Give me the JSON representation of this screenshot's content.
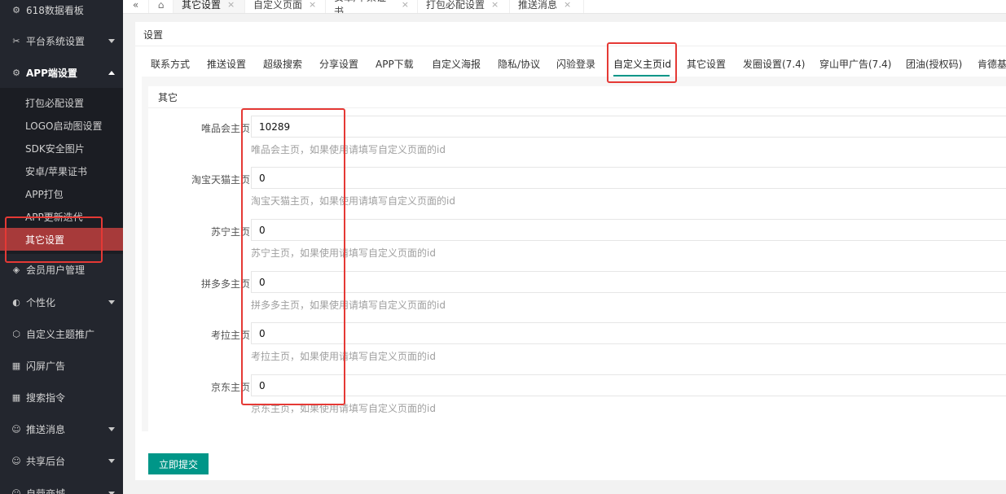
{
  "sidebar": {
    "items": [
      {
        "label": "618数据看板",
        "icon": "gear-icon",
        "arrow": false
      },
      {
        "label": "平台系统设置",
        "icon": "wrench-icon",
        "arrow": true
      },
      {
        "label": "APP端设置",
        "icon": "gear-icon",
        "arrow": true,
        "expanded": true
      },
      {
        "label": "会员用户管理",
        "icon": "shield-icon",
        "arrow": false
      },
      {
        "label": "个性化",
        "icon": "palette-icon",
        "arrow": true
      },
      {
        "label": "自定义主题推广",
        "icon": "cube-icon",
        "arrow": false
      },
      {
        "label": "闪屏广告",
        "icon": "grid-icon",
        "arrow": false
      },
      {
        "label": "搜索指令",
        "icon": "grid-icon",
        "arrow": false
      },
      {
        "label": "推送消息",
        "icon": "user-icon",
        "arrow": true
      },
      {
        "label": "共享后台",
        "icon": "user-icon",
        "arrow": true
      },
      {
        "label": "自营商城",
        "icon": "user-icon",
        "arrow": true
      }
    ],
    "submenu": [
      {
        "label": "打包必配设置"
      },
      {
        "label": "LOGO启动图设置"
      },
      {
        "label": "SDK安全图片"
      },
      {
        "label": "安卓/苹果证书"
      },
      {
        "label": "APP打包"
      },
      {
        "label": "APP更新迭代"
      },
      {
        "label": "其它设置",
        "active": true
      }
    ]
  },
  "tabs": [
    {
      "label": "其它设置",
      "active": true
    },
    {
      "label": "自定义页面"
    },
    {
      "label": "安卓/苹果证书"
    },
    {
      "label": "打包必配设置"
    },
    {
      "label": "推送消息"
    }
  ],
  "tab_close_glyph": "×",
  "card": {
    "title": "设置",
    "subtabs": [
      {
        "label": "联系方式"
      },
      {
        "label": "推送设置"
      },
      {
        "label": "超级搜索"
      },
      {
        "label": "分享设置"
      },
      {
        "label": "APP下载"
      },
      {
        "label": "自定义海报"
      },
      {
        "label": "隐私/协议"
      },
      {
        "label": "闪验登录"
      },
      {
        "label": "自定义主页id",
        "active": true
      },
      {
        "label": "其它设置"
      },
      {
        "label": "发圈设置(7.4)"
      },
      {
        "label": "穿山甲广告(7.4)"
      },
      {
        "label": "团油(授权码)"
      },
      {
        "label": "肯德基"
      }
    ],
    "panel_title": "其它",
    "fields": [
      {
        "label": "唯品会主页",
        "value": "10289",
        "help": "唯品会主页，如果使用请填写自定义页面的id"
      },
      {
        "label": "淘宝天猫主页",
        "value": "0",
        "help": "淘宝天猫主页，如果使用请填写自定义页面的id"
      },
      {
        "label": "苏宁主页",
        "value": "0",
        "help": "苏宁主页，如果使用请填写自定义页面的id"
      },
      {
        "label": "拼多多主页",
        "value": "0",
        "help": "拼多多主页，如果使用请填写自定义页面的id"
      },
      {
        "label": "考拉主页",
        "value": "0",
        "help": "考拉主页，如果使用请填写自定义页面的id"
      },
      {
        "label": "京东主页",
        "value": "0",
        "help": "京东主页，如果使用请填写自定义页面的id"
      }
    ],
    "submit_label": "立即提交"
  },
  "colors": {
    "sidebar_bg": "#23262e",
    "active_red": "#a73a3a",
    "accent_teal": "#009688",
    "annotation_red": "#e53935"
  }
}
